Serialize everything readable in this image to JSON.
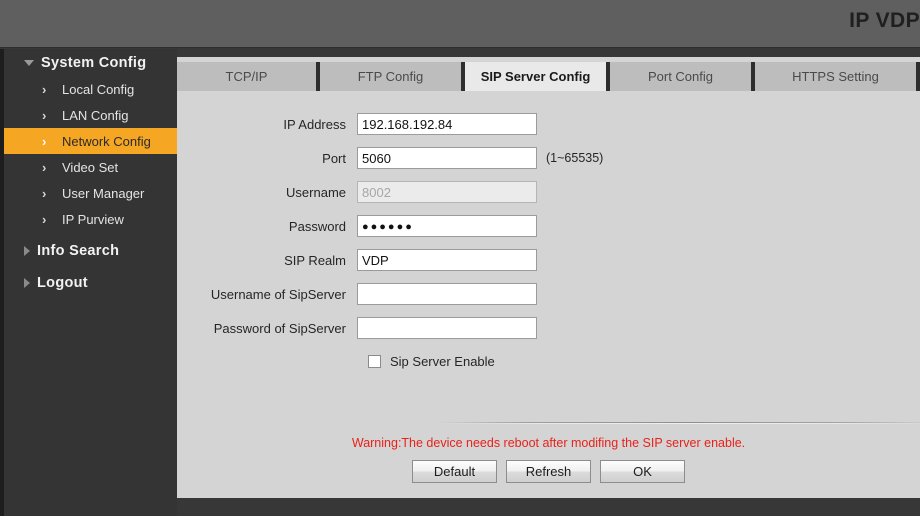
{
  "header": {
    "title": "IP VDP"
  },
  "sidebar": {
    "groups": [
      {
        "label": "System Config",
        "expanded": true,
        "items": [
          {
            "label": "Local Config",
            "active": false
          },
          {
            "label": "LAN Config",
            "active": false
          },
          {
            "label": "Network Config",
            "active": true
          },
          {
            "label": "Video Set",
            "active": false
          },
          {
            "label": "User Manager",
            "active": false
          },
          {
            "label": "IP Purview",
            "active": false
          }
        ]
      },
      {
        "label": "Info Search",
        "expanded": false,
        "items": []
      },
      {
        "label": "Logout",
        "expanded": false,
        "items": []
      }
    ],
    "chevron_glyph": "›",
    "active_color": "#f5a623"
  },
  "tabs": [
    {
      "label": "TCP/IP",
      "active": false
    },
    {
      "label": "FTP Config",
      "active": false
    },
    {
      "label": "SIP Server Config",
      "active": true
    },
    {
      "label": "Port Config",
      "active": false
    },
    {
      "label": "HTTPS Setting",
      "active": false
    }
  ],
  "form": {
    "fields": [
      {
        "label": "IP Address",
        "value": "192.168.192.84",
        "placeholder": "",
        "hint": "",
        "disabled": false,
        "masked": false
      },
      {
        "label": "Port",
        "value": "5060",
        "placeholder": "",
        "hint": "(1~65535)",
        "disabled": false,
        "masked": false
      },
      {
        "label": "Username",
        "value": "8002",
        "placeholder": "",
        "hint": "",
        "disabled": true,
        "masked": false
      },
      {
        "label": "Password",
        "value": "●●●●●●",
        "placeholder": "",
        "hint": "",
        "disabled": false,
        "masked": true
      },
      {
        "label": "SIP Realm",
        "value": "VDP",
        "placeholder": "",
        "hint": "",
        "disabled": false,
        "masked": false
      },
      {
        "label": "Username of SipServer",
        "value": "",
        "placeholder": "",
        "hint": "",
        "disabled": false,
        "masked": false
      },
      {
        "label": "Password of SipServer",
        "value": "",
        "placeholder": "",
        "hint": "",
        "disabled": false,
        "masked": false
      }
    ],
    "checkbox": {
      "label": "Sip Server Enable",
      "checked": false
    },
    "warning": "Warning:The device needs reboot after modifing the SIP server enable.",
    "warning_color": "#e8221b",
    "buttons": [
      {
        "label": "Default"
      },
      {
        "label": "Refresh"
      },
      {
        "label": "OK"
      }
    ]
  }
}
